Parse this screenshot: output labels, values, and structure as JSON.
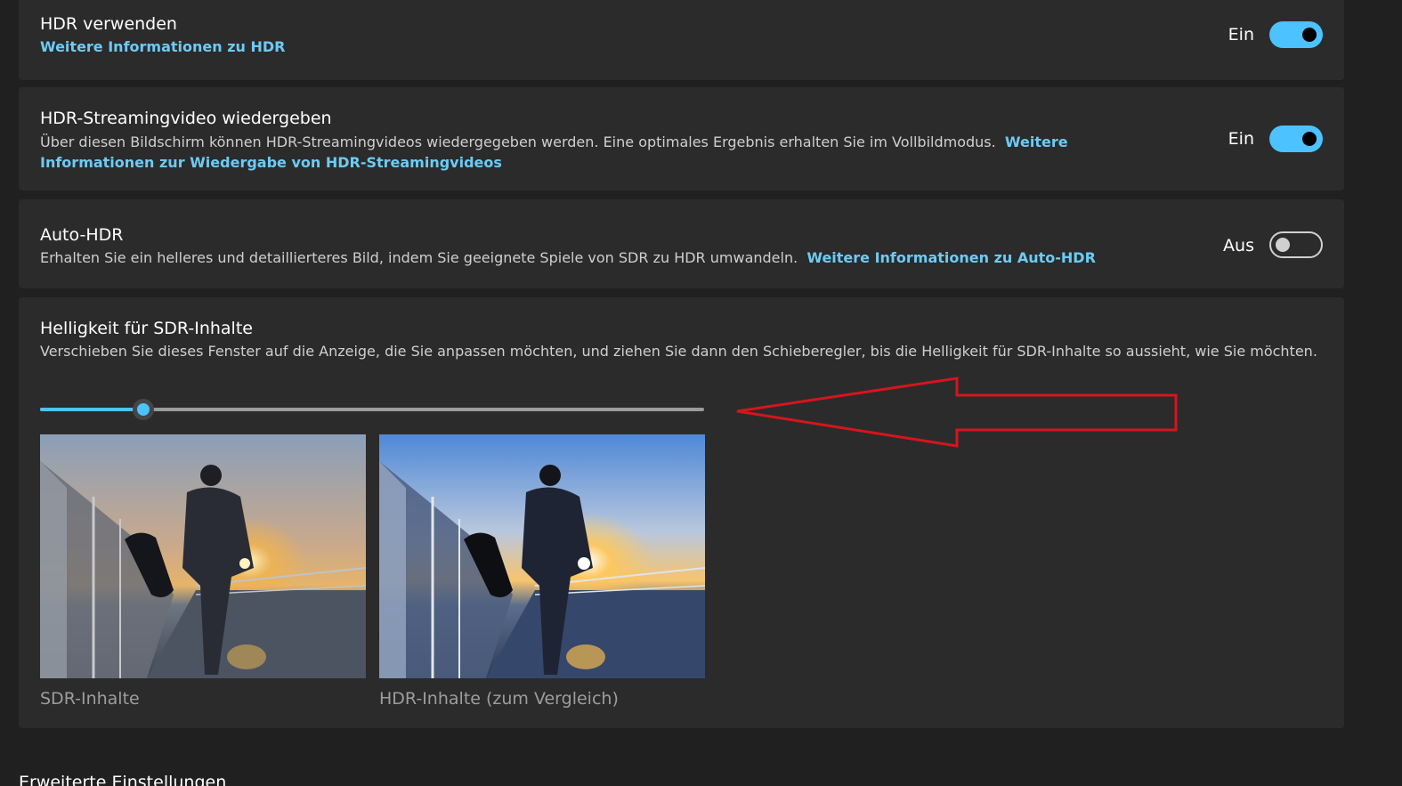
{
  "settings": {
    "hdr": {
      "title": "HDR verwenden",
      "link": "Weitere Informationen zu HDR",
      "state": "Ein",
      "enabled": true
    },
    "streaming": {
      "title": "HDR-Streamingvideo wiedergeben",
      "description": "Über diesen Bildschirm können HDR-Streamingvideos wiedergegeben werden. Eine optimales Ergebnis erhalten Sie im Vollbildmodus.",
      "link": "Weitere Informationen zur Wiedergabe von HDR-Streamingvideos",
      "state": "Ein",
      "enabled": true
    },
    "auto_hdr": {
      "title": "Auto-HDR",
      "description": "Erhalten Sie ein helleres und detaillierteres Bild, indem Sie geeignete Spiele von SDR zu HDR umwandeln.",
      "link": "Weitere Informationen zu Auto-HDR",
      "state": "Aus",
      "enabled": false
    },
    "sdr_brightness": {
      "title": "Helligkeit für SDR-Inhalte",
      "description": "Verschieben Sie dieses Fenster auf die Anzeige, die Sie anpassen möchten, und ziehen Sie dann den Schieberegler, bis die Helligkeit für SDR-Inhalte so aussieht, wie Sie möchten.",
      "slider_value_fraction": 0.155,
      "sdr_caption": "SDR-Inhalte",
      "hdr_caption": "HDR-Inhalte (zum Vergleich)"
    }
  },
  "next_section_title": "Erweiterte Einstellungen",
  "colors": {
    "accent": "#4cc2ff",
    "link": "#6ccbf5",
    "annotation_arrow": "#d7141c"
  },
  "annotation": {
    "type": "arrow",
    "direction": "left",
    "points_to": "sdr-brightness-slider"
  }
}
